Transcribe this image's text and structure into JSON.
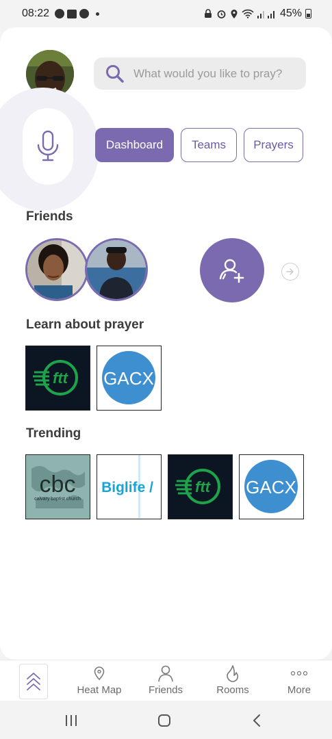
{
  "status_bar": {
    "time": "08:22",
    "battery": "45%"
  },
  "search": {
    "placeholder": "What would you like to pray?"
  },
  "tabs": [
    {
      "label": "Dashboard",
      "active": true
    },
    {
      "label": "Teams",
      "active": false
    },
    {
      "label": "Prayers",
      "active": false
    }
  ],
  "sections": {
    "friends": "Friends",
    "learn": "Learn about prayer",
    "trending": "Trending"
  },
  "thumbnails": {
    "ftt": "ftt",
    "gacx": "GACX",
    "cbc": "cbc",
    "cbc_sub": "calvary baptist church",
    "biglife": "Biglife /"
  },
  "bottom_nav": [
    {
      "label": "Heat Map",
      "icon": "map-pin-icon"
    },
    {
      "label": "Friends",
      "icon": "person-icon"
    },
    {
      "label": "Rooms",
      "icon": "flame-icon"
    },
    {
      "label": "More",
      "icon": "more-dots-icon"
    }
  ],
  "colors": {
    "accent": "#7b6aaf",
    "ftt_green": "#1fa34a",
    "gacx_blue": "#3e8fd0",
    "biglife_blue": "#1aa3d6"
  }
}
